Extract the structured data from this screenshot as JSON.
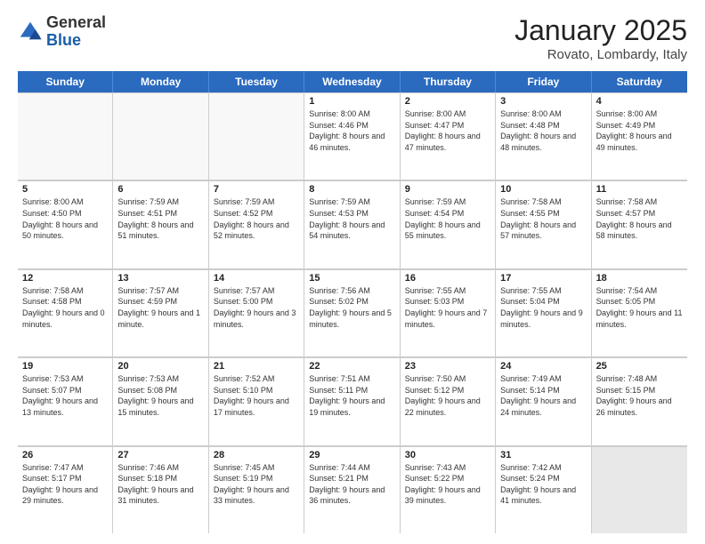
{
  "logo": {
    "general": "General",
    "blue": "Blue"
  },
  "title": "January 2025",
  "subtitle": "Rovato, Lombardy, Italy",
  "days": [
    "Sunday",
    "Monday",
    "Tuesday",
    "Wednesday",
    "Thursday",
    "Friday",
    "Saturday"
  ],
  "weeks": [
    [
      {
        "day": "",
        "empty": true
      },
      {
        "day": "",
        "empty": true
      },
      {
        "day": "",
        "empty": true
      },
      {
        "day": "1",
        "sunrise": "8:00 AM",
        "sunset": "4:46 PM",
        "daylight": "8 hours and 46 minutes."
      },
      {
        "day": "2",
        "sunrise": "8:00 AM",
        "sunset": "4:47 PM",
        "daylight": "8 hours and 47 minutes."
      },
      {
        "day": "3",
        "sunrise": "8:00 AM",
        "sunset": "4:48 PM",
        "daylight": "8 hours and 48 minutes."
      },
      {
        "day": "4",
        "sunrise": "8:00 AM",
        "sunset": "4:49 PM",
        "daylight": "8 hours and 49 minutes."
      }
    ],
    [
      {
        "day": "5",
        "sunrise": "8:00 AM",
        "sunset": "4:50 PM",
        "daylight": "8 hours and 50 minutes."
      },
      {
        "day": "6",
        "sunrise": "7:59 AM",
        "sunset": "4:51 PM",
        "daylight": "8 hours and 51 minutes."
      },
      {
        "day": "7",
        "sunrise": "7:59 AM",
        "sunset": "4:52 PM",
        "daylight": "8 hours and 52 minutes."
      },
      {
        "day": "8",
        "sunrise": "7:59 AM",
        "sunset": "4:53 PM",
        "daylight": "8 hours and 54 minutes."
      },
      {
        "day": "9",
        "sunrise": "7:59 AM",
        "sunset": "4:54 PM",
        "daylight": "8 hours and 55 minutes."
      },
      {
        "day": "10",
        "sunrise": "7:58 AM",
        "sunset": "4:55 PM",
        "daylight": "8 hours and 57 minutes."
      },
      {
        "day": "11",
        "sunrise": "7:58 AM",
        "sunset": "4:57 PM",
        "daylight": "8 hours and 58 minutes."
      }
    ],
    [
      {
        "day": "12",
        "sunrise": "7:58 AM",
        "sunset": "4:58 PM",
        "daylight": "9 hours and 0 minutes."
      },
      {
        "day": "13",
        "sunrise": "7:57 AM",
        "sunset": "4:59 PM",
        "daylight": "9 hours and 1 minute."
      },
      {
        "day": "14",
        "sunrise": "7:57 AM",
        "sunset": "5:00 PM",
        "daylight": "9 hours and 3 minutes."
      },
      {
        "day": "15",
        "sunrise": "7:56 AM",
        "sunset": "5:02 PM",
        "daylight": "9 hours and 5 minutes."
      },
      {
        "day": "16",
        "sunrise": "7:55 AM",
        "sunset": "5:03 PM",
        "daylight": "9 hours and 7 minutes."
      },
      {
        "day": "17",
        "sunrise": "7:55 AM",
        "sunset": "5:04 PM",
        "daylight": "9 hours and 9 minutes."
      },
      {
        "day": "18",
        "sunrise": "7:54 AM",
        "sunset": "5:05 PM",
        "daylight": "9 hours and 11 minutes."
      }
    ],
    [
      {
        "day": "19",
        "sunrise": "7:53 AM",
        "sunset": "5:07 PM",
        "daylight": "9 hours and 13 minutes."
      },
      {
        "day": "20",
        "sunrise": "7:53 AM",
        "sunset": "5:08 PM",
        "daylight": "9 hours and 15 minutes."
      },
      {
        "day": "21",
        "sunrise": "7:52 AM",
        "sunset": "5:10 PM",
        "daylight": "9 hours and 17 minutes."
      },
      {
        "day": "22",
        "sunrise": "7:51 AM",
        "sunset": "5:11 PM",
        "daylight": "9 hours and 19 minutes."
      },
      {
        "day": "23",
        "sunrise": "7:50 AM",
        "sunset": "5:12 PM",
        "daylight": "9 hours and 22 minutes."
      },
      {
        "day": "24",
        "sunrise": "7:49 AM",
        "sunset": "5:14 PM",
        "daylight": "9 hours and 24 minutes."
      },
      {
        "day": "25",
        "sunrise": "7:48 AM",
        "sunset": "5:15 PM",
        "daylight": "9 hours and 26 minutes."
      }
    ],
    [
      {
        "day": "26",
        "sunrise": "7:47 AM",
        "sunset": "5:17 PM",
        "daylight": "9 hours and 29 minutes."
      },
      {
        "day": "27",
        "sunrise": "7:46 AM",
        "sunset": "5:18 PM",
        "daylight": "9 hours and 31 minutes."
      },
      {
        "day": "28",
        "sunrise": "7:45 AM",
        "sunset": "5:19 PM",
        "daylight": "9 hours and 33 minutes."
      },
      {
        "day": "29",
        "sunrise": "7:44 AM",
        "sunset": "5:21 PM",
        "daylight": "9 hours and 36 minutes."
      },
      {
        "day": "30",
        "sunrise": "7:43 AM",
        "sunset": "5:22 PM",
        "daylight": "9 hours and 39 minutes."
      },
      {
        "day": "31",
        "sunrise": "7:42 AM",
        "sunset": "5:24 PM",
        "daylight": "9 hours and 41 minutes."
      },
      {
        "day": "",
        "empty": true,
        "shaded": true
      }
    ]
  ],
  "labels": {
    "sunrise": "Sunrise:",
    "sunset": "Sunset:",
    "daylight": "Daylight:"
  }
}
